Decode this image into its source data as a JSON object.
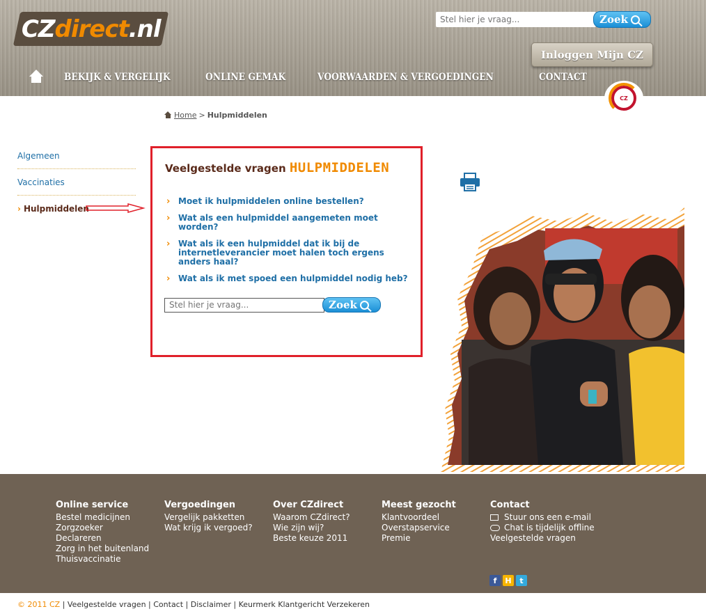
{
  "header": {
    "logo_main": "CZ",
    "logo_accent": "direct",
    "logo_suffix": ".nl",
    "search_placeholder": "Stel hier je vraag...",
    "search_button": "Zoek",
    "login_button": "Inloggen Mijn CZ",
    "nav": [
      "BEKIJK & VERGELIJK",
      "ONLINE GEMAK",
      "VOORWAARDEN & VERGOEDINGEN",
      "CONTACT"
    ],
    "badge_text": "CZ"
  },
  "breadcrumb": {
    "home": "Home",
    "separator": ">",
    "current": "Hulpmiddelen"
  },
  "sidebar": {
    "items": [
      "Algemeen",
      "Vaccinaties",
      "Hulpmiddelen"
    ],
    "active_index": 2
  },
  "main": {
    "title_prefix": "Veelgestelde vragen",
    "title_accent": "HULPMIDDELEN",
    "faq": [
      "Moet ik hulpmiddelen online bestellen?",
      "Wat als een hulpmiddel aangemeten moet worden?",
      "Wat als ik een hulpmiddel dat ik bij de internetleverancier moet halen toch ergens anders haal?",
      "Wat als ik met spoed een hulpmiddel nodig heb?"
    ],
    "search_placeholder": "Stel hier je vraag...",
    "search_button": "Zoek"
  },
  "footer": {
    "columns": [
      {
        "title": "Online service",
        "links": [
          "Bestel medicijnen",
          "Zorgzoeker",
          "Declareren",
          "Zorg in het buitenland",
          "Thuisvaccinatie"
        ]
      },
      {
        "title": "Vergoedingen",
        "links": [
          "Vergelijk pakketten",
          "Wat krijg ik vergoed?"
        ]
      },
      {
        "title": "Over CZdirect",
        "links": [
          "Waarom CZdirect?",
          "Wie zijn wij?",
          "Beste keuze 2011"
        ]
      },
      {
        "title": "Meest gezocht",
        "links": [
          "Klantvoordeel",
          "Overstapservice",
          "Premie"
        ]
      },
      {
        "title": "Contact",
        "links": [
          "Stuur ons een e-mail",
          "Chat is tijdelijk offline",
          "Veelgestelde vragen"
        ]
      }
    ],
    "social": [
      "f",
      "H",
      "t"
    ]
  },
  "bottom_bar": {
    "copyright": "© 2011 CZ",
    "links": [
      "Veelgestelde vragen",
      "Contact",
      "Disclaimer",
      "Keurmerk Klantgericht Verzekeren"
    ]
  },
  "colors": {
    "accent_orange": "#f08a00",
    "link_blue": "#1f6fa6",
    "brand_brown": "#6f6254",
    "annotation_red": "#e0202a"
  },
  "icons": [
    "home-icon",
    "search-icon",
    "print-icon",
    "email-icon",
    "chat-icon",
    "facebook-icon",
    "hyves-icon",
    "twitter-icon"
  ]
}
